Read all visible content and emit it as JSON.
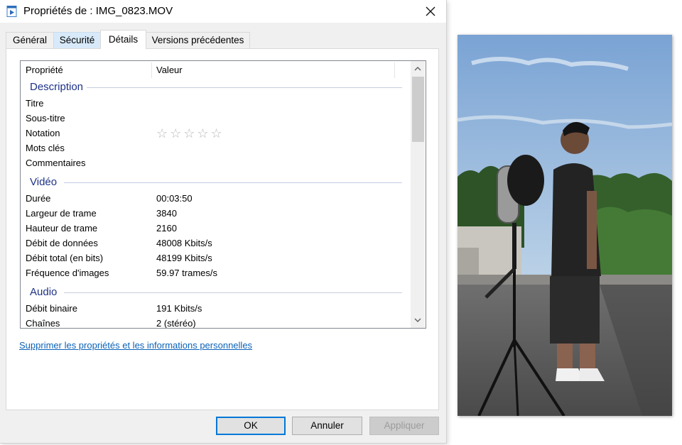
{
  "window": {
    "title": "Propriétés de : IMG_0823.MOV",
    "icon": "video-file-icon",
    "close_icon": "close-icon"
  },
  "tabs": [
    {
      "label": "Général"
    },
    {
      "label": "Sécurité"
    },
    {
      "label": "Détails"
    },
    {
      "label": "Versions précédentes"
    }
  ],
  "list": {
    "column_property": "Propriété",
    "column_value": "Valeur",
    "groups": {
      "description": "Description",
      "video": "Vidéo",
      "audio": "Audio"
    },
    "rows": {
      "titre": {
        "name": "Titre",
        "value": ""
      },
      "sous_titre": {
        "name": "Sous-titre",
        "value": ""
      },
      "notation": {
        "name": "Notation",
        "stars": "☆☆☆☆☆",
        "rating": 0,
        "max_rating": 5
      },
      "mots_cles": {
        "name": "Mots clés",
        "value": ""
      },
      "commentaires": {
        "name": "Commentaires",
        "value": ""
      },
      "duree": {
        "name": "Durée",
        "value": "00:03:50"
      },
      "largeur": {
        "name": "Largeur de trame",
        "value": "3840"
      },
      "hauteur": {
        "name": "Hauteur de trame",
        "value": "2160"
      },
      "debit_donnees": {
        "name": "Débit de données",
        "value": "48008 Kbits/s"
      },
      "debit_total": {
        "name": "Débit total (en bits)",
        "value": "48199 Kbits/s"
      },
      "frequence": {
        "name": "Fréquence d'images",
        "value": "59.97 trames/s"
      },
      "debit_binaire": {
        "name": "Débit binaire",
        "value": "191 Kbits/s"
      },
      "chaines": {
        "name": "Chaînes",
        "value": "2 (stéréo)"
      }
    }
  },
  "link_remove_properties": "Supprimer les propriétés et les informations personnelles",
  "buttons": {
    "ok": "OK",
    "cancel": "Annuler",
    "apply": "Appliquer"
  },
  "colors": {
    "accent": "#0078d7",
    "group_header": "#1e3287",
    "link": "#0b62b8",
    "sky": "#8fb6df",
    "foliage": "#2f5a2a"
  }
}
